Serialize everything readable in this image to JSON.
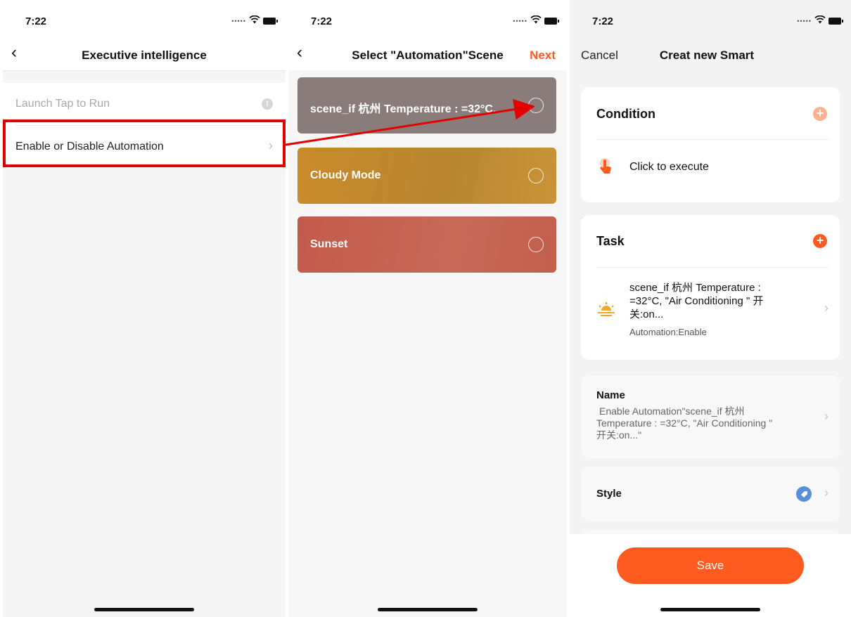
{
  "colors": {
    "accent": "#ff5a1f",
    "highlight": "#e50000"
  },
  "panel1": {
    "time": "7:22",
    "title": "Executive intelligence",
    "items": [
      {
        "label": "Launch Tap to Run",
        "state": "disabled",
        "icon": "info-icon"
      },
      {
        "label": "Enable or Disable Automation",
        "icon": "chevron-right-icon"
      }
    ]
  },
  "panel2": {
    "time": "7:22",
    "title": "Select \"Automation\"Scene",
    "next_label": "Next",
    "scenes": [
      {
        "name": "scene_if 杭州 Temperature : =32°C...",
        "color": "#8a7c7b"
      },
      {
        "name": "Cloudy Mode",
        "color": "#c98d2c"
      },
      {
        "name": "Sunset",
        "color": "#c65f4f"
      }
    ]
  },
  "panel3": {
    "time": "7:22",
    "cancel_label": "Cancel",
    "title": "Creat new Smart",
    "condition": {
      "title": "Condition",
      "item": "Click to execute",
      "icon": "tap-hand-icon"
    },
    "task": {
      "title": "Task",
      "item_line1": "scene_if 杭州 Temperature :",
      "item_line2": "=32°C, \"Air Conditioning \" 开",
      "item_line3": "关:on...",
      "item_sub": "Automation:Enable",
      "icon": "sunrise-icon"
    },
    "name": {
      "label": "Name",
      "line1": "Enable Automation\"scene_if 杭州",
      "line2": "Temperature : =32°C, \"Air Conditioning \"",
      "line3": "开关:on...\""
    },
    "style": {
      "label": "Style",
      "icon": "tag-icon"
    },
    "save_label": "Save"
  }
}
